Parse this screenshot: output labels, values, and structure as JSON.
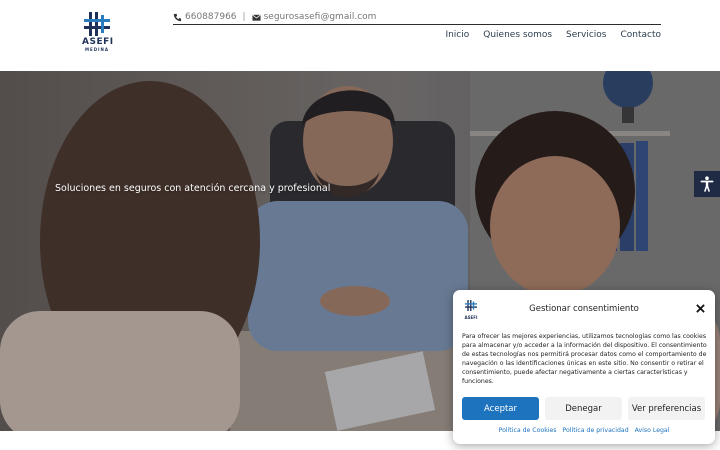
{
  "brand": {
    "name": "ASEFI",
    "subtitle": "MEDINA",
    "primary_color": "#1f3158",
    "accent_color": "#2b7bbf"
  },
  "topbar": {
    "phone": "660887966",
    "separator": "|",
    "email": "segurosasefi@gmail.com"
  },
  "nav": [
    "Inicio",
    "Quienes somos",
    "Servicios",
    "Contacto"
  ],
  "hero": {
    "tagline": "Soluciones en seguros con atención cercana y profesional"
  },
  "accessibility": {
    "icon": "accessibility-icon"
  },
  "consent": {
    "title": "Gestionar consentimiento",
    "message": "Para ofrecer las mejores experiencias, utilizamos tecnologías como las cookies para almacenar y/o acceder a la información del dispositivo. El consentimiento de estas tecnologías nos permitirá procesar datos como el comportamiento de navegación o las identificaciones únicas en este sitio. No consentir o retirar el consentimiento, puede afectar negativamente a ciertas características y funciones.",
    "accept": "Aceptar",
    "deny": "Denegar",
    "preferences": "Ver preferencias",
    "links": [
      "Política de Cookies",
      "Política de privacidad",
      "Aviso Legal"
    ],
    "accept_color": "#1e73be"
  }
}
